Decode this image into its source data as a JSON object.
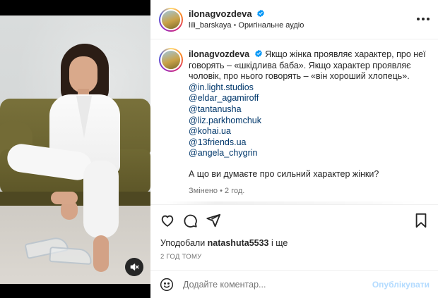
{
  "post": {
    "author": "ilonagvozdeva",
    "verified": true,
    "audio_user": "lili_barskaya",
    "audio_separator": "•",
    "audio_label": "Оригінальне аудіо"
  },
  "caption": {
    "author": "ilonagvozdeva",
    "text": "Якщо жінка проявляє характер, про неї говорять – «шкідлива баба». Якщо характер проявляє чоловік, про нього говорять – «він хороший хлопець».",
    "tags": [
      "@in.light.studios",
      "@eldar_agamiroff",
      "@tantanusha",
      "@liz.parkhomchuk",
      "@kohai.ua",
      "@13friends.ua",
      "@angela_chygrin"
    ],
    "question": "А що ви думаєте про сильний характер жінки?",
    "edited": "Змінено",
    "edited_separator": "•",
    "edited_time": "2 год."
  },
  "actions": {
    "liked_by_prefix": "Уподобали",
    "liked_by_user": "natashuta5533",
    "liked_by_suffix": "і ще",
    "posted_time": "2 ГОД ТОМУ"
  },
  "comment": {
    "placeholder": "Додайте коментар...",
    "publish_label": "Опублікувати"
  },
  "icons": {
    "verified": "verified-badge-icon",
    "more": "more-horizontal-icon",
    "like": "heart-icon",
    "comment": "comment-icon",
    "share": "paper-plane-icon",
    "save": "bookmark-icon",
    "emoji": "emoji-smile-icon",
    "mute": "speaker-muted-icon"
  },
  "colors": {
    "link": "#00376b",
    "verified": "#0095f6",
    "publish_disabled": "#b3dbff",
    "secondary_text": "#737373"
  }
}
